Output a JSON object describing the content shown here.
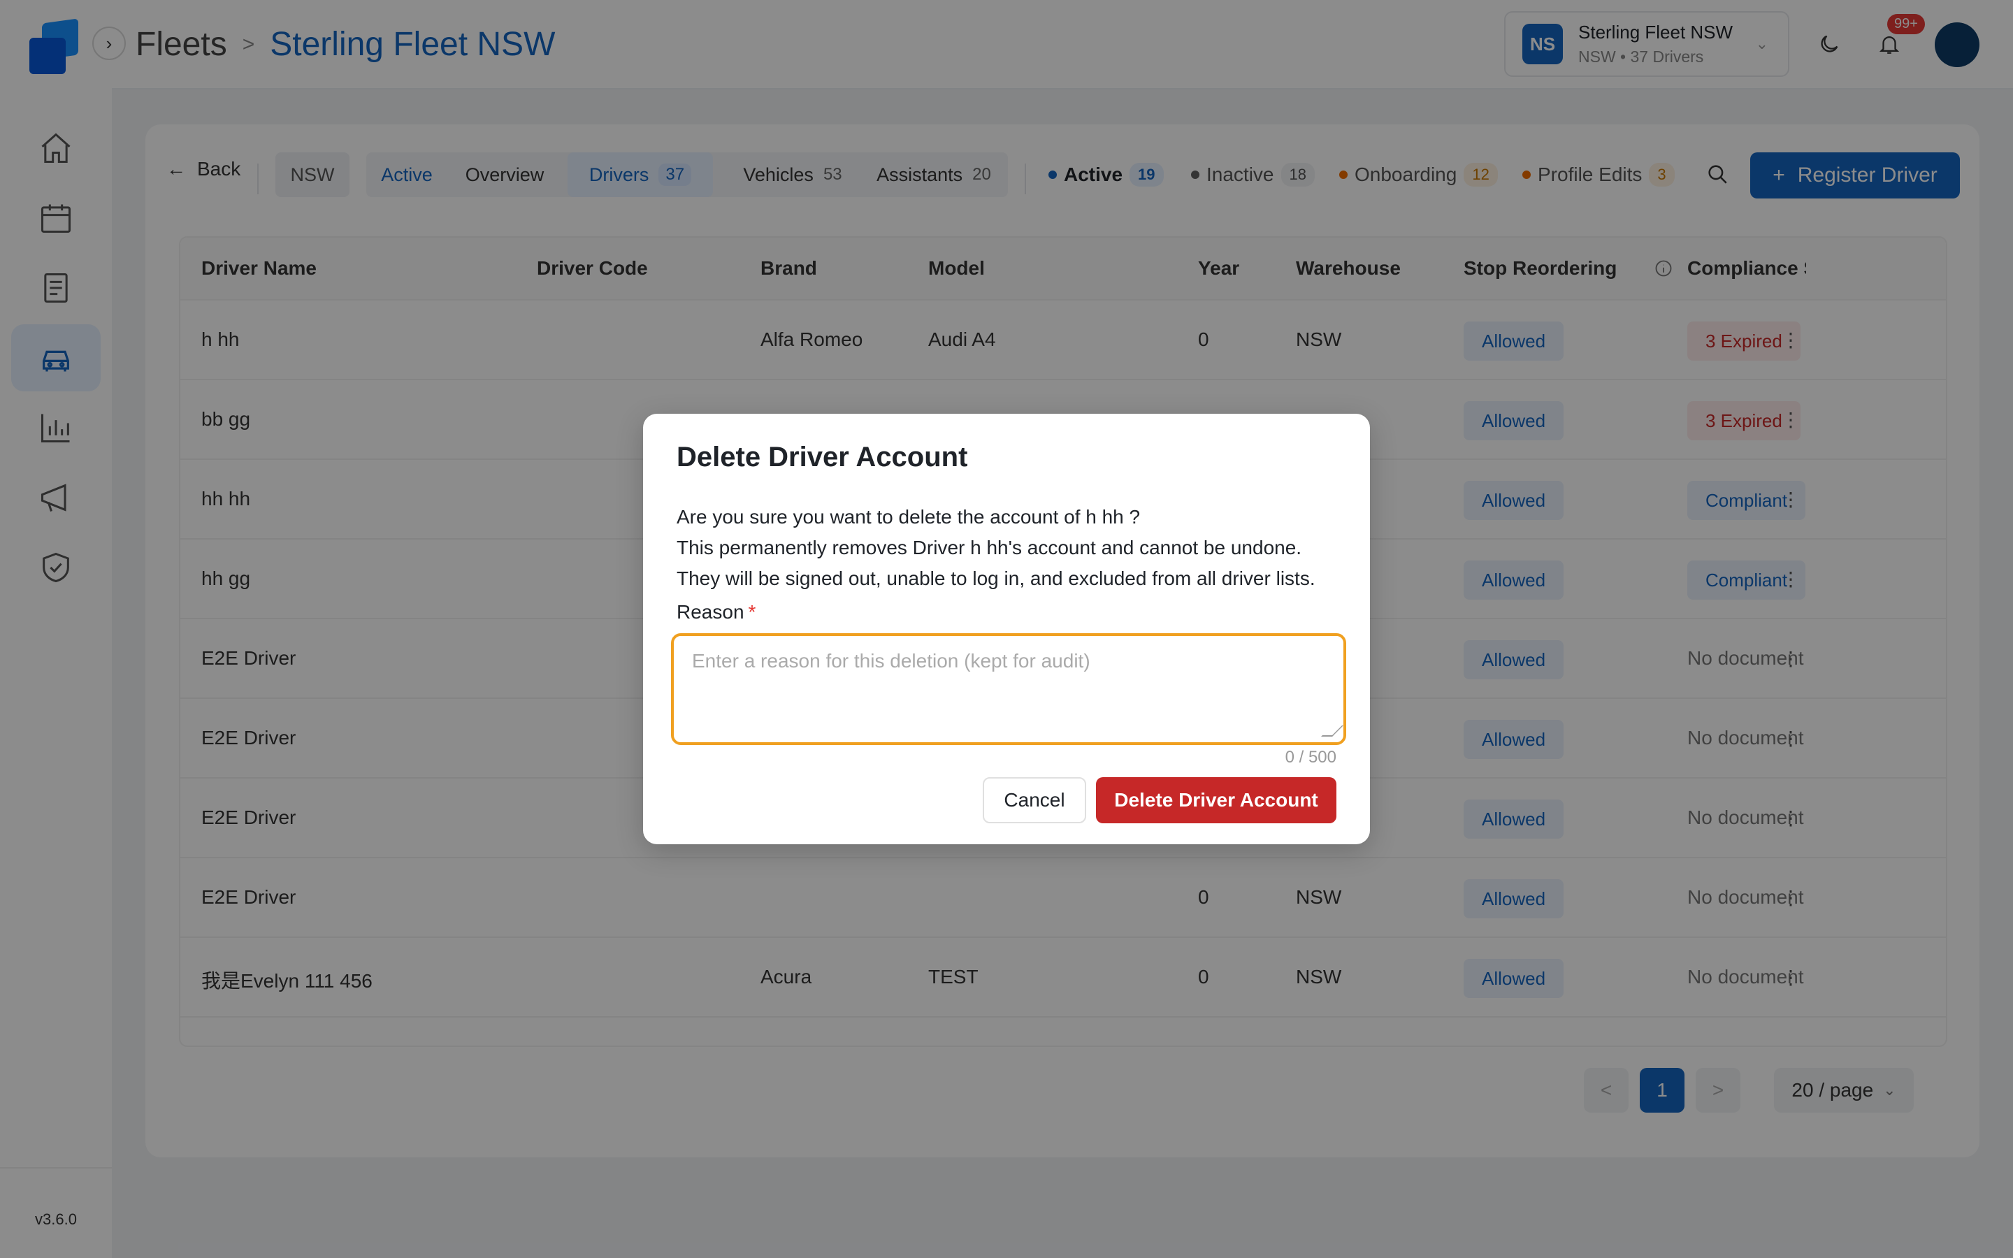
{
  "app": {
    "version": "v3.6.0"
  },
  "header": {
    "breadcrumb_root": "Fleets",
    "breadcrumb_sep": ">",
    "breadcrumb_current": "Sterling Fleet NSW",
    "fleet_switcher": {
      "initials": "NS",
      "name": "Sterling Fleet NSW",
      "subtitle": "NSW • 37 Drivers"
    },
    "notification_badge": "99+"
  },
  "sidebar": {
    "items": [
      {
        "icon": "home-icon"
      },
      {
        "icon": "calendar-icon"
      },
      {
        "icon": "document-icon"
      },
      {
        "icon": "car-icon",
        "active": true
      },
      {
        "icon": "chart-icon"
      },
      {
        "icon": "megaphone-icon"
      },
      {
        "icon": "shield-check-icon"
      }
    ]
  },
  "toolbar": {
    "back_label": "Back",
    "region_chip": "NSW",
    "tabs": [
      {
        "label": "Active",
        "count": ""
      },
      {
        "label": "Overview",
        "count": ""
      },
      {
        "label": "Drivers",
        "count": "37"
      },
      {
        "label": "Vehicles",
        "count": "53"
      },
      {
        "label": "Assistants",
        "count": "20"
      }
    ],
    "status_filters": [
      {
        "label": "Active",
        "count": "19",
        "color": "#1565c0"
      },
      {
        "label": "Inactive",
        "count": "18",
        "color": "#616161"
      },
      {
        "label": "Onboarding",
        "count": "12",
        "color": "#ef6c00"
      },
      {
        "label": "Profile Edits",
        "count": "3",
        "color": "#ef6c00"
      }
    ],
    "register_label": "Register Driver"
  },
  "table": {
    "columns": [
      "Driver Name",
      "Driver Code",
      "Brand",
      "Model",
      "Year",
      "Warehouse",
      "Stop Reordering",
      "Compliance S"
    ],
    "rows": [
      {
        "name": "h hh",
        "code": "",
        "brand": "Alfa Romeo",
        "model": "Audi A4",
        "year": "0",
        "warehouse": "NSW",
        "stop": "Allowed",
        "compliance": "3 Expired",
        "ctype": "expired"
      },
      {
        "name": "bb gg",
        "code": "",
        "brand": "",
        "model": "",
        "year": "",
        "warehouse": "",
        "stop": "Allowed",
        "compliance": "3 Expired",
        "ctype": "expired"
      },
      {
        "name": "hh hh",
        "code": "",
        "brand": "",
        "model": "",
        "year": "",
        "warehouse": "",
        "stop": "Allowed",
        "compliance": "Compliant",
        "ctype": "compliant"
      },
      {
        "name": "hh gg",
        "code": "",
        "brand": "",
        "model": "",
        "year": "",
        "warehouse": "",
        "stop": "Allowed",
        "compliance": "Compliant",
        "ctype": "compliant"
      },
      {
        "name": "E2E Driver",
        "code": "",
        "brand": "",
        "model": "",
        "year": "",
        "warehouse": "",
        "stop": "Allowed",
        "compliance": "No document",
        "ctype": "none"
      },
      {
        "name": "E2E Driver",
        "code": "",
        "brand": "",
        "model": "",
        "year": "",
        "warehouse": "",
        "stop": "Allowed",
        "compliance": "No document",
        "ctype": "none"
      },
      {
        "name": "E2E Driver",
        "code": "",
        "brand": "",
        "model": "",
        "year": "",
        "warehouse": "",
        "stop": "Allowed",
        "compliance": "No document",
        "ctype": "none"
      },
      {
        "name": "E2E Driver",
        "code": "",
        "brand": "",
        "model": "",
        "year": "0",
        "warehouse": "NSW",
        "stop": "Allowed",
        "compliance": "No document",
        "ctype": "none"
      },
      {
        "name": "我是Evelyn 111 456",
        "code": "",
        "brand": "Acura",
        "model": "TEST",
        "year": "0",
        "warehouse": "NSW",
        "stop": "Allowed",
        "compliance": "No document",
        "ctype": "none"
      }
    ],
    "row_menu_glyph": "⋮"
  },
  "pagination": {
    "prev": "<",
    "current": "1",
    "next": ">",
    "page_size": "20 / page"
  },
  "modal": {
    "title": "Delete Driver Account",
    "line1": "Are you sure you want to delete the account of h hh ?",
    "line2": "This permanently removes Driver h hh's account and cannot be undone.",
    "line3": "They will be signed out, unable to log in, and excluded from all driver lists.",
    "reason_label": "Reason",
    "required_mark": "*",
    "reason_placeholder": "Enter a reason for this deletion (kept for audit)",
    "reason_value": "",
    "counter": "0 / 500",
    "cancel_label": "Cancel",
    "delete_label": "Delete Driver Account"
  }
}
